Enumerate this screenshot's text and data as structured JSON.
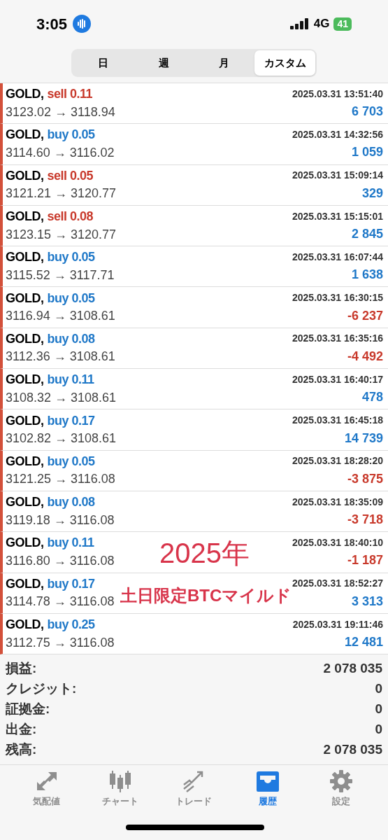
{
  "status_bar": {
    "time": "3:05",
    "network": "4G",
    "battery": "41"
  },
  "tabs": [
    {
      "label": "日",
      "selected": false
    },
    {
      "label": "週",
      "selected": false
    },
    {
      "label": "月",
      "selected": false
    },
    {
      "label": "カスタム",
      "selected": true
    }
  ],
  "trades": [
    {
      "symbol": "GOLD,",
      "side": "sell",
      "volume": "0.11",
      "time": "2025.03.31 13:51:40",
      "prices": "3123.02 → 3118.94",
      "profit": "6 703",
      "negative": false
    },
    {
      "symbol": "GOLD,",
      "side": "buy",
      "volume": "0.05",
      "time": "2025.03.31 14:32:56",
      "prices": "3114.60 → 3116.02",
      "profit": "1 059",
      "negative": false
    },
    {
      "symbol": "GOLD,",
      "side": "sell",
      "volume": "0.05",
      "time": "2025.03.31 15:09:14",
      "prices": "3121.21 → 3120.77",
      "profit": "329",
      "negative": false
    },
    {
      "symbol": "GOLD,",
      "side": "sell",
      "volume": "0.08",
      "time": "2025.03.31 15:15:01",
      "prices": "3123.15 → 3120.77",
      "profit": "2 845",
      "negative": false
    },
    {
      "symbol": "GOLD,",
      "side": "buy",
      "volume": "0.05",
      "time": "2025.03.31 16:07:44",
      "prices": "3115.52 → 3117.71",
      "profit": "1 638",
      "negative": false
    },
    {
      "symbol": "GOLD,",
      "side": "buy",
      "volume": "0.05",
      "time": "2025.03.31 16:30:15",
      "prices": "3116.94 → 3108.61",
      "profit": "-6 237",
      "negative": true
    },
    {
      "symbol": "GOLD,",
      "side": "buy",
      "volume": "0.08",
      "time": "2025.03.31 16:35:16",
      "prices": "3112.36 → 3108.61",
      "profit": "-4 492",
      "negative": true
    },
    {
      "symbol": "GOLD,",
      "side": "buy",
      "volume": "0.11",
      "time": "2025.03.31 16:40:17",
      "prices": "3108.32 → 3108.61",
      "profit": "478",
      "negative": false
    },
    {
      "symbol": "GOLD,",
      "side": "buy",
      "volume": "0.17",
      "time": "2025.03.31 16:45:18",
      "prices": "3102.82 → 3108.61",
      "profit": "14 739",
      "negative": false
    },
    {
      "symbol": "GOLD,",
      "side": "buy",
      "volume": "0.05",
      "time": "2025.03.31 18:28:20",
      "prices": "3121.25 → 3116.08",
      "profit": "-3 875",
      "negative": true
    },
    {
      "symbol": "GOLD,",
      "side": "buy",
      "volume": "0.08",
      "time": "2025.03.31 18:35:09",
      "prices": "3119.18 → 3116.08",
      "profit": "-3 718",
      "negative": true
    },
    {
      "symbol": "GOLD,",
      "side": "buy",
      "volume": "0.11",
      "time": "2025.03.31 18:40:10",
      "prices": "3116.80 → 3116.08",
      "profit": "-1 187",
      "negative": true
    },
    {
      "symbol": "GOLD,",
      "side": "buy",
      "volume": "0.17",
      "time": "2025.03.31 18:52:27",
      "prices": "3114.78 → 3116.08",
      "profit": "3 313",
      "negative": false
    },
    {
      "symbol": "GOLD,",
      "side": "buy",
      "volume": "0.25",
      "time": "2025.03.31 19:11:46",
      "prices": "3112.75 → 3116.08",
      "profit": "12 481",
      "negative": false
    }
  ],
  "overlay": {
    "line_1": "2025年",
    "line_2": "土日限定BTCマイルド"
  },
  "summary": [
    {
      "label": "損益:",
      "value": "2 078 035"
    },
    {
      "label": "クレジット:",
      "value": "0"
    },
    {
      "label": "証拠金:",
      "value": "0"
    },
    {
      "label": "出金:",
      "value": "0"
    },
    {
      "label": "残高:",
      "value": "2 078 035"
    }
  ],
  "nav": [
    {
      "label": "気配値",
      "kind": "quotes",
      "selected": false
    },
    {
      "label": "チャート",
      "kind": "chart",
      "selected": false
    },
    {
      "label": "トレード",
      "kind": "trade",
      "selected": false
    },
    {
      "label": "履歴",
      "kind": "history",
      "selected": true
    },
    {
      "label": "設定",
      "kind": "settings",
      "selected": false
    }
  ]
}
